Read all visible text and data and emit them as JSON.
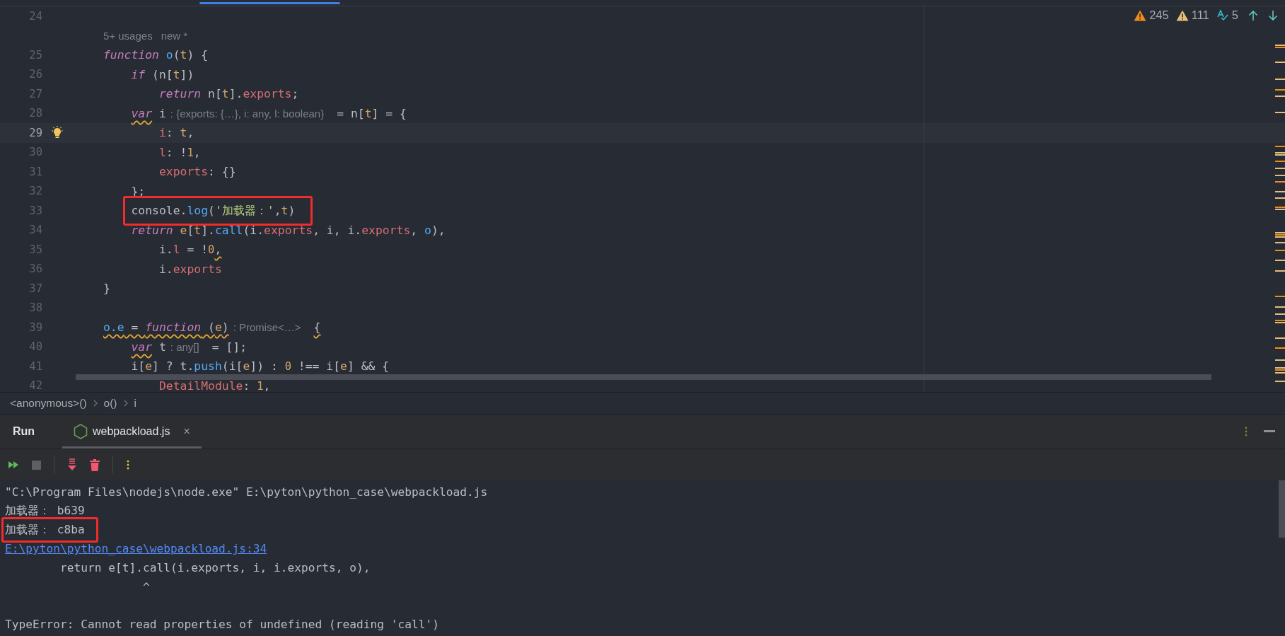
{
  "editor": {
    "inspections": [
      {
        "kind": "warning",
        "count": "245"
      },
      {
        "kind": "weak_warning",
        "count": "111"
      },
      {
        "kind": "typo",
        "count": "5"
      }
    ],
    "lines": [
      {
        "kind": "code",
        "number": "24",
        "current": false,
        "bulb": false,
        "highlighted": false
      },
      {
        "kind": "inlay",
        "texts": [
          "5+ usages",
          "new *"
        ]
      },
      {
        "kind": "code",
        "number": "25",
        "current": false,
        "bulb": false,
        "highlighted": false,
        "tokens": [
          {
            "text": "function",
            "kind": "kw"
          },
          {
            "text": " o",
            "kind": "fn"
          },
          {
            "text": "(",
            "kind": "plain"
          },
          {
            "text": "t",
            "kind": "param"
          },
          {
            "text": ") {",
            "kind": "plain"
          }
        ]
      },
      {
        "kind": "code",
        "number": "26",
        "current": false,
        "bulb": false,
        "highlighted": false,
        "tokens": [
          {
            "text": "    if",
            "kind": "kw"
          },
          {
            "text": " (n[",
            "kind": "plain"
          },
          {
            "text": "t",
            "kind": "param"
          },
          {
            "text": "])",
            "kind": "plain"
          }
        ]
      },
      {
        "kind": "code",
        "number": "27",
        "current": false,
        "bulb": false,
        "highlighted": false,
        "tokens": [
          {
            "text": "        return",
            "kind": "kw"
          },
          {
            "text": " n[",
            "kind": "plain"
          },
          {
            "text": "t",
            "kind": "param"
          },
          {
            "text": "].",
            "kind": "plain"
          },
          {
            "text": "exports",
            "kind": "prop"
          },
          {
            "text": ";",
            "kind": "plain"
          }
        ]
      },
      {
        "kind": "code",
        "number": "28",
        "current": false,
        "bulb": false,
        "highlighted": false,
        "tokens": [
          {
            "text": "    var",
            "kind": "kw",
            "squiggle": true
          },
          {
            "text": " i",
            "kind": "plain"
          },
          {
            "text": ": {exports: {…}, i: any, l: boolean}",
            "kind": "hint"
          },
          {
            "text": "= n[",
            "kind": "plain"
          },
          {
            "text": "t",
            "kind": "param"
          },
          {
            "text": "] = {",
            "kind": "plain"
          }
        ]
      },
      {
        "kind": "code",
        "number": "29",
        "current": true,
        "bulb": true,
        "highlighted": false,
        "tokens": [
          {
            "text": "        i",
            "kind": "prop"
          },
          {
            "text": ": ",
            "kind": "plain"
          },
          {
            "text": "t",
            "kind": "param"
          },
          {
            "text": ",",
            "kind": "plain"
          }
        ]
      },
      {
        "kind": "code",
        "number": "30",
        "current": false,
        "bulb": false,
        "highlighted": false,
        "tokens": [
          {
            "text": "        l",
            "kind": "prop"
          },
          {
            "text": ": !",
            "kind": "plain"
          },
          {
            "text": "1",
            "kind": "num"
          },
          {
            "text": ",",
            "kind": "plain"
          }
        ]
      },
      {
        "kind": "code",
        "number": "31",
        "current": false,
        "bulb": false,
        "highlighted": false,
        "tokens": [
          {
            "text": "        exports",
            "kind": "prop"
          },
          {
            "text": ": {}",
            "kind": "plain"
          }
        ]
      },
      {
        "kind": "code",
        "number": "32",
        "current": false,
        "bulb": false,
        "highlighted": false,
        "tokens": [
          {
            "text": "    };",
            "kind": "plain"
          }
        ]
      },
      {
        "kind": "code",
        "number": "33",
        "current": false,
        "bulb": false,
        "highlighted": true,
        "tokens": [
          {
            "text": "    console.",
            "kind": "plain"
          },
          {
            "text": "log",
            "kind": "fn"
          },
          {
            "text": "(",
            "kind": "plain"
          },
          {
            "text": "'加载器：'",
            "kind": "str"
          },
          {
            "text": ",",
            "kind": "plain"
          },
          {
            "text": "t",
            "kind": "param"
          },
          {
            "text": ")",
            "kind": "plain"
          }
        ]
      },
      {
        "kind": "code",
        "number": "34",
        "current": false,
        "bulb": false,
        "highlighted": false,
        "tokens": [
          {
            "text": "    return",
            "kind": "kw"
          },
          {
            "text": " e",
            "kind": "param"
          },
          {
            "text": "[",
            "kind": "plain"
          },
          {
            "text": "t",
            "kind": "param"
          },
          {
            "text": "].",
            "kind": "plain"
          },
          {
            "text": "call",
            "kind": "fn"
          },
          {
            "text": "(i.",
            "kind": "plain"
          },
          {
            "text": "exports",
            "kind": "prop"
          },
          {
            "text": ", i, i.",
            "kind": "plain"
          },
          {
            "text": "exports",
            "kind": "prop"
          },
          {
            "text": ", ",
            "kind": "plain"
          },
          {
            "text": "o",
            "kind": "fn"
          },
          {
            "text": "),",
            "kind": "plain"
          }
        ]
      },
      {
        "kind": "code",
        "number": "35",
        "current": false,
        "bulb": false,
        "highlighted": false,
        "tokens": [
          {
            "text": "        i.",
            "kind": "plain"
          },
          {
            "text": "l",
            "kind": "prop"
          },
          {
            "text": " = !",
            "kind": "plain"
          },
          {
            "text": "0",
            "kind": "num"
          },
          {
            "text": ",",
            "kind": "plain",
            "squiggle": true
          }
        ]
      },
      {
        "kind": "code",
        "number": "36",
        "current": false,
        "bulb": false,
        "highlighted": false,
        "tokens": [
          {
            "text": "        i.",
            "kind": "plain"
          },
          {
            "text": "exports",
            "kind": "prop"
          }
        ]
      },
      {
        "kind": "code",
        "number": "37",
        "current": false,
        "bulb": false,
        "highlighted": false,
        "tokens": [
          {
            "text": "}",
            "kind": "plain"
          }
        ]
      },
      {
        "kind": "code",
        "number": "38",
        "current": false,
        "bulb": false,
        "highlighted": false
      },
      {
        "kind": "code",
        "number": "39",
        "current": false,
        "bulb": false,
        "highlighted": false,
        "tokens": [
          {
            "text": "o.e",
            "kind": "fn",
            "squiggle": true
          },
          {
            "text": " = ",
            "kind": "plain",
            "squiggle": true
          },
          {
            "text": "function",
            "kind": "kw",
            "squiggle": true
          },
          {
            "text": " (",
            "kind": "plain",
            "squiggle": true
          },
          {
            "text": "e",
            "kind": "param",
            "squiggle": true
          },
          {
            "text": ")",
            "kind": "plain",
            "squiggle": true
          },
          {
            "text": ": Promise<…>",
            "kind": "hint"
          },
          {
            "text": "{",
            "kind": "plain",
            "squiggle": true
          }
        ]
      },
      {
        "kind": "code",
        "number": "40",
        "current": false,
        "bulb": false,
        "highlighted": false,
        "tokens": [
          {
            "text": "    var",
            "kind": "kw",
            "squiggle": true
          },
          {
            "text": " t",
            "kind": "plain"
          },
          {
            "text": ": any[]",
            "kind": "hint"
          },
          {
            "text": "= [];",
            "kind": "plain"
          }
        ]
      },
      {
        "kind": "code",
        "number": "41",
        "current": false,
        "bulb": false,
        "highlighted": false,
        "tokens": [
          {
            "text": "    i[",
            "kind": "plain"
          },
          {
            "text": "e",
            "kind": "param"
          },
          {
            "text": "] ? t.",
            "kind": "plain"
          },
          {
            "text": "push",
            "kind": "fn"
          },
          {
            "text": "(i[",
            "kind": "plain"
          },
          {
            "text": "e",
            "kind": "param"
          },
          {
            "text": "]) : ",
            "kind": "plain"
          },
          {
            "text": "0",
            "kind": "num"
          },
          {
            "text": " !== i[",
            "kind": "plain"
          },
          {
            "text": "e",
            "kind": "param"
          },
          {
            "text": "] && {",
            "kind": "plain"
          }
        ]
      },
      {
        "kind": "code",
        "number": "42",
        "current": false,
        "bulb": false,
        "highlighted": false,
        "tokens": [
          {
            "text": "        DetailModule",
            "kind": "prop"
          },
          {
            "text": ": ",
            "kind": "plain"
          },
          {
            "text": "1",
            "kind": "num"
          },
          {
            "text": ",",
            "kind": "plain"
          }
        ]
      }
    ]
  },
  "breadcrumbs": [
    "<anonymous>()",
    "o()",
    "i"
  ],
  "run_panel": {
    "title": "Run",
    "tabs": [
      {
        "label": "webpackload.js",
        "close": "×",
        "selected": true
      }
    ],
    "console": [
      {
        "kind": "command",
        "text": "\"C:\\Program Files\\nodejs\\node.exe\" E:\\pyton\\python_case\\webpackload.js",
        "highlighted": false
      },
      {
        "kind": "output",
        "text": "加载器： b639",
        "highlighted": false
      },
      {
        "kind": "output",
        "text": "加载器： c8ba",
        "highlighted": true
      },
      {
        "kind": "link",
        "text": "E:\\pyton\\python_case\\webpackload.js:34",
        "highlighted": false
      },
      {
        "kind": "output",
        "text": "        return e[t].call(i.exports, i, i.exports, o),",
        "highlighted": false
      },
      {
        "kind": "output",
        "text": "                    ^",
        "highlighted": false
      },
      {
        "kind": "blank"
      },
      {
        "kind": "output",
        "text": "TypeError: Cannot read properties of undefined (reading 'call')",
        "highlighted": false
      }
    ]
  }
}
